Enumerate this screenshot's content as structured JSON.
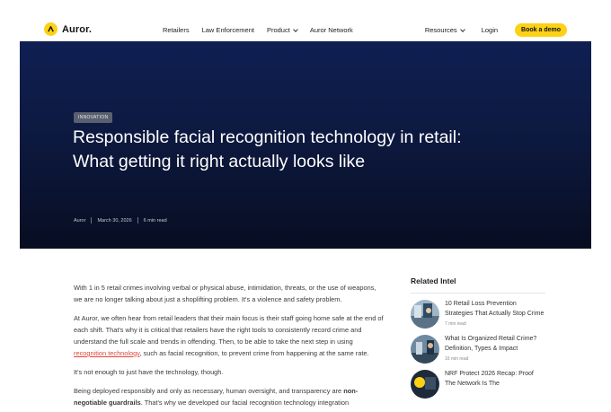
{
  "nav": {
    "logo_text": "Auror.",
    "links": [
      {
        "label": "Retailers",
        "dropdown": false
      },
      {
        "label": "Law Enforcement",
        "dropdown": false
      },
      {
        "label": "Product",
        "dropdown": true
      },
      {
        "label": "Auror Network",
        "dropdown": false
      }
    ],
    "resources_label": "Resources",
    "login_label": "Login",
    "demo_label": "Book a demo"
  },
  "colors": {
    "brand_yellow": "#fcd116",
    "hero_bg": "#0d1a42",
    "link_red": "#e0453a"
  },
  "hero": {
    "tag": "INNOVATION",
    "title": "Responsible facial recognition technology in retail: What getting it right actually looks like",
    "author": "Auror",
    "date": "March 30, 2026",
    "read_time": "6 min read"
  },
  "article": {
    "p1": "With 1 in 5 retail crimes involving verbal or physical abuse, intimidation, threats, or the use of weapons, we are no longer talking about just a shoplifting problem. It's a violence and safety problem.",
    "p2_a": "At Auror, we often hear from retail leaders that their main focus is their staff going home safe at the end of each shift. That's why it is critical that retailers have the right tools to consistently record crime and understand the full scale and trends in offending. Then, to be able to take the next step in using ",
    "p2_link": "recognition technology",
    "p2_b": ", such as facial recognition, to prevent crime from happening at the same rate.",
    "p3": "It's not enough to just have the technology, though.",
    "p4_a": "Being deployed responsibly and only as necessary, human oversight, and transparency are ",
    "p4_bold": "non-negotiable guardrails",
    "p4_b": ". That's why we developed our facial recognition technology integration"
  },
  "sidebar": {
    "heading": "Related Intel",
    "items": [
      {
        "title": "10 Retail Loss Prevention Strategies That Actually Stop Crime",
        "read": "7 min read"
      },
      {
        "title": "What Is Organized Retail Crime? Definition, Types & Impact",
        "read": "16 min read"
      },
      {
        "title": "NRF Protect 2026 Recap: Proof The Network Is The",
        "read": ""
      }
    ]
  }
}
